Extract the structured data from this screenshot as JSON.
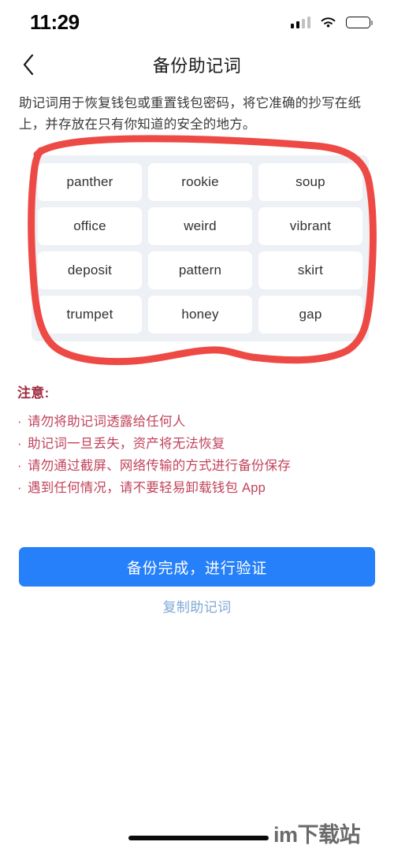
{
  "status_bar": {
    "time": "11:29",
    "signal_icon": "cellular-signal-icon",
    "signal_bars_total": 4,
    "signal_bars_active": 2,
    "wifi_icon": "wifi-icon",
    "battery_icon": "battery-full-icon",
    "battery_level_percent": 100
  },
  "nav": {
    "back_icon": "chevron-left-icon",
    "title": "备份助记词"
  },
  "description": "助记词用于恢复钱包或重置钱包密码，将它准确的抄写在纸上，并存放在只有你知道的安全的地方。",
  "mnemonic": {
    "words": [
      "panther",
      "rookie",
      "soup",
      "office",
      "weird",
      "vibrant",
      "deposit",
      "pattern",
      "skirt",
      "trumpet",
      "honey",
      "gap"
    ]
  },
  "annotation": {
    "type": "hand-drawn-circle",
    "color": "#ee4a45"
  },
  "notice": {
    "title": "注意:",
    "bullet": "·",
    "items": [
      "请勿将助记词透露给任何人",
      "助记词一旦丢失，资产将无法恢复",
      "请勿通过截屏、网络传输的方式进行备份保存",
      "遇到任何情况，请不要轻易卸载钱包 App"
    ]
  },
  "actions": {
    "primary_label": "备份完成，进行验证",
    "primary_color": "#2680fa",
    "copy_label": "复制助记词",
    "copy_color": "#7ea8d4"
  },
  "footer": {
    "home_indicator": "home-indicator",
    "watermark": "im下载站"
  }
}
